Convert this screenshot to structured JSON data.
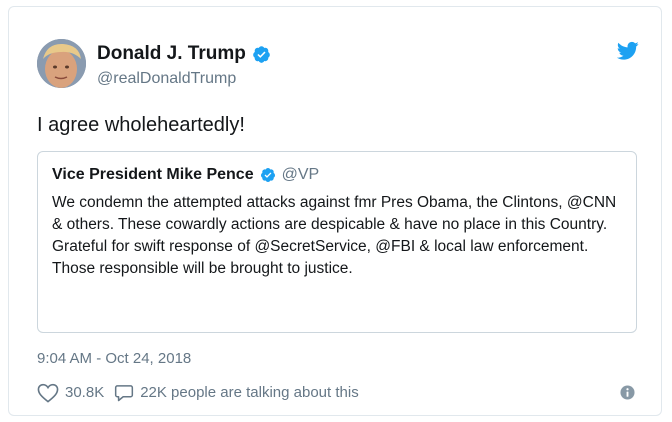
{
  "author": {
    "display_name": "Donald J. Trump",
    "handle": "@realDonaldTrump",
    "verified_icon": "verified-badge-icon",
    "avatar_icon": "avatar"
  },
  "tweet": {
    "text": "I agree wholeheartedly!",
    "timestamp": "9:04 AM - Oct 24, 2018"
  },
  "quoted_tweet": {
    "display_name": "Vice President Mike Pence",
    "handle": "@VP",
    "text": "We condemn the attempted attacks against fmr Pres Obama, the Clintons, @CNN & others. These cowardly actions are despicable & have no place in this Country. Grateful for swift response of @SecretService, @FBI & local law enforcement. Those responsible will be brought to justice."
  },
  "actions": {
    "likes": "30.8K",
    "conversation": "22K people are talking about this"
  },
  "icons": {
    "brand": "twitter-bird-icon",
    "like": "heart-icon",
    "reply": "speech-bubble-icon",
    "info": "info-icon"
  },
  "colors": {
    "brand": "#1da1f2",
    "verified": "#1da1f2",
    "secondary_text": "#657786",
    "primary_text": "#14171a",
    "border": "#e1e8ed"
  }
}
